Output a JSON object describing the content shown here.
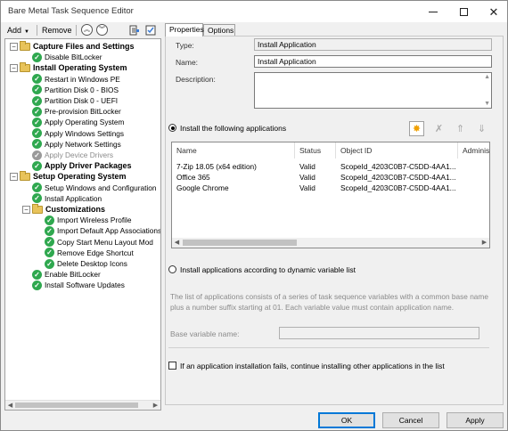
{
  "window": {
    "title": "Bare Metal Task Sequence Editor"
  },
  "toolbar": {
    "add_label": "Add",
    "remove_label": "Remove"
  },
  "tree": {
    "items": [
      {
        "label": "Capture Files and Settings",
        "type": "group",
        "level": 0
      },
      {
        "label": "Disable BitLocker",
        "type": "step",
        "level": 1
      },
      {
        "label": "Install Operating System",
        "type": "group",
        "level": 0
      },
      {
        "label": "Restart in Windows PE",
        "type": "step",
        "level": 1
      },
      {
        "label": "Partition Disk 0 - BIOS",
        "type": "step",
        "level": 1
      },
      {
        "label": "Partition Disk 0 - UEFI",
        "type": "step",
        "level": 1
      },
      {
        "label": "Pre-provision BitLocker",
        "type": "step",
        "level": 1
      },
      {
        "label": "Apply Operating System",
        "type": "step",
        "level": 1
      },
      {
        "label": "Apply Windows Settings",
        "type": "step",
        "level": 1
      },
      {
        "label": "Apply Network Settings",
        "type": "step",
        "level": 1
      },
      {
        "label": "Apply Device Drivers",
        "type": "step-disabled",
        "level": 1
      },
      {
        "label": "Apply Driver Packages",
        "type": "step-bold",
        "level": 1
      },
      {
        "label": "Setup Operating System",
        "type": "group",
        "level": 0
      },
      {
        "label": "Setup Windows and Configuration",
        "type": "step",
        "level": 1
      },
      {
        "label": "Install Application",
        "type": "step",
        "level": 1
      },
      {
        "label": "Customizations",
        "type": "group",
        "level": 1
      },
      {
        "label": "Import Wireless Profile",
        "type": "step",
        "level": 2
      },
      {
        "label": "Import Default App Associations",
        "type": "step",
        "level": 2
      },
      {
        "label": "Copy Start Menu Layout Mod",
        "type": "step",
        "level": 2
      },
      {
        "label": "Remove Edge Shortcut",
        "type": "step",
        "level": 2
      },
      {
        "label": "Delete Desktop Icons",
        "type": "step",
        "level": 2
      },
      {
        "label": "Enable BitLocker",
        "type": "step",
        "level": 1
      },
      {
        "label": "Install Software Updates",
        "type": "step",
        "level": 1
      }
    ]
  },
  "tabs": {
    "properties": "Properties",
    "options": "Options"
  },
  "props": {
    "type_label": "Type:",
    "type_value": "Install Application",
    "name_label": "Name:",
    "name_value": "Install Application",
    "description_label": "Description:",
    "description_value": ""
  },
  "radio1_label": "Install the following applications",
  "apps_table": {
    "columns": [
      "Name",
      "Status",
      "Object ID",
      "Administ"
    ],
    "rows": [
      [
        "7-Zip 18.05 (x64 edition)",
        "Valid",
        "ScopeId_4203C0B7-C5DD-4AA1...",
        ""
      ],
      [
        "Office 365",
        "Valid",
        "ScopeId_4203C0B7-C5DD-4AA1...",
        ""
      ],
      [
        "Google Chrome",
        "Valid",
        "ScopeId_4203C0B7-C5DD-4AA1...",
        ""
      ]
    ]
  },
  "radio2_label": "Install applications according to dynamic variable list",
  "info_text": "The list of applications consists of a series of task sequence variables with a common base name plus a number suffix starting at 01. Each variable value must contain application name.",
  "base_var_label": "Base variable name:",
  "base_var_value": "",
  "checkbox_label": "If an application installation fails, continue installing other applications in the list",
  "buttons": {
    "ok": "OK",
    "cancel": "Cancel",
    "apply": "Apply"
  }
}
